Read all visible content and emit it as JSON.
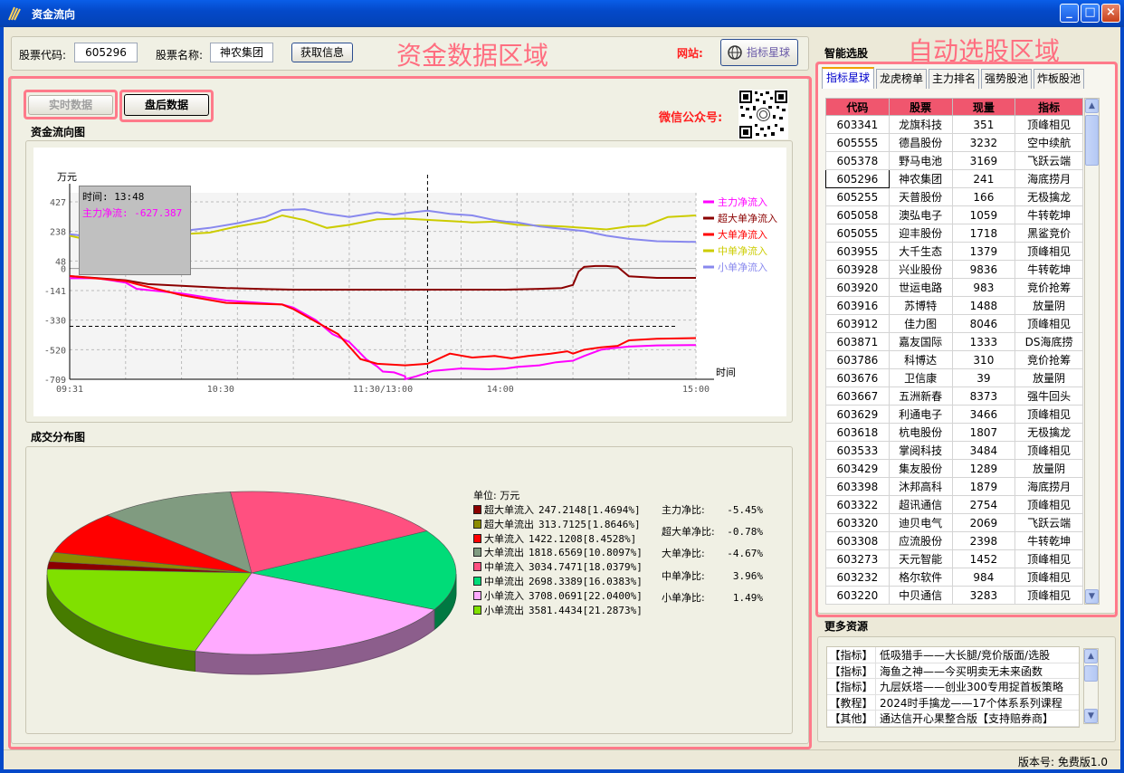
{
  "window": {
    "title": "资金流向"
  },
  "top_bar": {
    "code_label": "股票代码:",
    "code_value": "605296",
    "name_label": "股票名称:",
    "name_value": "神农集团",
    "fetch_button": "获取信息",
    "overlay_label": "资金数据区域",
    "website_label": "网站:",
    "website_button": "指标星球"
  },
  "data_section": {
    "realtime_button": "实时数据",
    "afterhours_button": "盘后数据",
    "wechat_label": "微信公众号:",
    "flow_chart_title": "资金流向图",
    "distribution_title": "成交分布图"
  },
  "tooltip": {
    "time": "时间: 13:48",
    "value": "主力净流: -627.387"
  },
  "chart_data": [
    {
      "type": "line",
      "title": "",
      "ylabel": "万元",
      "xlabel": "时间",
      "y_ticks": [
        "427",
        "238",
        "48",
        "0",
        "-141",
        "-330",
        "-520",
        "-709"
      ],
      "x_ticks": [
        "09:31",
        "10:30",
        "11:30/13:00",
        "14:00",
        "15:00"
      ],
      "ylim": [
        -709,
        427
      ],
      "grid": true,
      "legend": "top-right",
      "crosshair": {
        "x": "13:48",
        "y": -370
      },
      "series": [
        {
          "name": "主力净流入",
          "color": "#ff00ff",
          "values": [
            [
              0,
              -62
            ],
            [
              0.05,
              -62
            ],
            [
              0.1,
              -90
            ],
            [
              0.12,
              -130
            ],
            [
              0.2,
              -160
            ],
            [
              0.28,
              -205
            ],
            [
              0.38,
              -230
            ],
            [
              0.4,
              -250
            ],
            [
              0.44,
              -330
            ],
            [
              0.47,
              -420
            ],
            [
              0.5,
              -470
            ],
            [
              0.53,
              -580
            ],
            [
              0.55,
              -627
            ],
            [
              0.56,
              -660
            ],
            [
              0.58,
              -665
            ],
            [
              0.6,
              -690
            ],
            [
              0.6,
              -709
            ],
            [
              0.62,
              -690
            ],
            [
              0.65,
              -655
            ],
            [
              0.7,
              -640
            ],
            [
              0.75,
              -645
            ],
            [
              0.78,
              -640
            ],
            [
              0.8,
              -630
            ],
            [
              0.84,
              -620
            ],
            [
              0.87,
              -600
            ],
            [
              0.9,
              -590
            ],
            [
              0.92,
              -560
            ],
            [
              0.95,
              -520
            ],
            [
              0.97,
              -510
            ],
            [
              1.0,
              -500
            ],
            [
              1.05,
              -492
            ],
            [
              1.12,
              -490
            ]
          ]
        },
        {
          "name": "超大单净流入",
          "color": "#8b0000",
          "values": [
            [
              0,
              -48
            ],
            [
              0.1,
              -75
            ],
            [
              0.14,
              -100
            ],
            [
              0.2,
              -110
            ],
            [
              0.28,
              -125
            ],
            [
              0.35,
              -132
            ],
            [
              0.4,
              -135
            ],
            [
              0.5,
              -135
            ],
            [
              0.6,
              -135
            ],
            [
              0.7,
              -135
            ],
            [
              0.78,
              -135
            ],
            [
              0.84,
              -130
            ],
            [
              0.88,
              -125
            ],
            [
              0.9,
              -105
            ],
            [
              0.91,
              -20
            ],
            [
              0.92,
              10
            ],
            [
              0.94,
              16
            ],
            [
              0.96,
              16
            ],
            [
              0.98,
              10
            ],
            [
              1.0,
              -50
            ],
            [
              1.05,
              -60
            ],
            [
              1.12,
              -60
            ]
          ]
        },
        {
          "name": "大单净流入",
          "color": "#ff0000",
          "values": [
            [
              0,
              -48
            ],
            [
              0.1,
              -80
            ],
            [
              0.12,
              -100
            ],
            [
              0.2,
              -170
            ],
            [
              0.28,
              -220
            ],
            [
              0.38,
              -230
            ],
            [
              0.4,
              -260
            ],
            [
              0.45,
              -360
            ],
            [
              0.48,
              -420
            ],
            [
              0.52,
              -580
            ],
            [
              0.55,
              -610
            ],
            [
              0.6,
              -620
            ],
            [
              0.64,
              -610
            ],
            [
              0.68,
              -545
            ],
            [
              0.72,
              -570
            ],
            [
              0.76,
              -560
            ],
            [
              0.79,
              -575
            ],
            [
              0.82,
              -560
            ],
            [
              0.86,
              -545
            ],
            [
              0.89,
              -530
            ],
            [
              0.9,
              -545
            ],
            [
              0.92,
              -520
            ],
            [
              0.95,
              -505
            ],
            [
              0.98,
              -495
            ],
            [
              1.0,
              -460
            ],
            [
              1.05,
              -450
            ],
            [
              1.12,
              -445
            ]
          ]
        },
        {
          "name": "中单净流入",
          "color": "#cccc00",
          "values": [
            [
              0,
              210
            ],
            [
              0.05,
              170
            ],
            [
              0.1,
              205
            ],
            [
              0.15,
              190
            ],
            [
              0.2,
              220
            ],
            [
              0.25,
              230
            ],
            [
              0.3,
              270
            ],
            [
              0.35,
              300
            ],
            [
              0.38,
              340
            ],
            [
              0.42,
              310
            ],
            [
              0.46,
              260
            ],
            [
              0.5,
              280
            ],
            [
              0.55,
              315
            ],
            [
              0.6,
              320
            ],
            [
              0.65,
              310
            ],
            [
              0.7,
              300
            ],
            [
              0.72,
              295
            ],
            [
              0.76,
              300
            ],
            [
              0.8,
              280
            ],
            [
              0.84,
              275
            ],
            [
              0.88,
              270
            ],
            [
              0.92,
              260
            ],
            [
              0.96,
              250
            ],
            [
              1.0,
              270
            ],
            [
              1.03,
              275
            ],
            [
              1.07,
              330
            ],
            [
              1.12,
              340
            ]
          ]
        },
        {
          "name": "小单净流入",
          "color": "#8888ee",
          "values": [
            [
              0,
              220
            ],
            [
              0.05,
              200
            ],
            [
              0.1,
              210
            ],
            [
              0.15,
              205
            ],
            [
              0.2,
              240
            ],
            [
              0.25,
              260
            ],
            [
              0.3,
              290
            ],
            [
              0.35,
              330
            ],
            [
              0.38,
              375
            ],
            [
              0.42,
              380
            ],
            [
              0.46,
              350
            ],
            [
              0.5,
              330
            ],
            [
              0.55,
              360
            ],
            [
              0.58,
              345
            ],
            [
              0.6,
              355
            ],
            [
              0.64,
              370
            ],
            [
              0.68,
              350
            ],
            [
              0.72,
              340
            ],
            [
              0.76,
              310
            ],
            [
              0.78,
              300
            ],
            [
              0.8,
              295
            ],
            [
              0.84,
              270
            ],
            [
              0.88,
              255
            ],
            [
              0.92,
              240
            ],
            [
              0.96,
              210
            ],
            [
              1.0,
              190
            ],
            [
              1.05,
              175
            ],
            [
              1.12,
              170
            ]
          ]
        }
      ]
    },
    {
      "type": "pie",
      "title": "",
      "unit_label": "单位: 万元",
      "slices": [
        {
          "name": "超大单流入",
          "value": 247.2148,
          "pct": "1.4694%",
          "color": "#8b0000"
        },
        {
          "name": "超大单流出",
          "value": 313.7125,
          "pct": "1.8646%",
          "color": "#8b8b00"
        },
        {
          "name": "大单流入",
          "value": 1422.1208,
          "pct": "8.4528%",
          "color": "#ff0000"
        },
        {
          "name": "大单流出",
          "value": 1818.6569,
          "pct": "10.8097%",
          "color": "#809b80"
        },
        {
          "name": "中单流入",
          "value": 3034.7471,
          "pct": "18.0379%",
          "color": "#ff5080"
        },
        {
          "name": "中单流出",
          "value": 2698.3389,
          "pct": "16.0383%",
          "color": "#00dc78"
        },
        {
          "name": "小单流入",
          "value": 3708.0691,
          "pct": "22.0400%",
          "color": "#ffaaff"
        },
        {
          "name": "小单流出",
          "value": 3581.4434,
          "pct": "21.2873%",
          "color": "#80e000"
        }
      ]
    }
  ],
  "legend_rows": [
    {
      "name": "超大单流入",
      "text": "247.2148[1.4694%]",
      "color": "#8b0000"
    },
    {
      "name": "超大单流出",
      "text": "313.7125[1.8646%]",
      "color": "#8b8b00"
    },
    {
      "name": "大单流入",
      "text": "1422.1208[8.4528%]",
      "color": "#ff0000"
    },
    {
      "name": "大单流出",
      "text": "1818.6569[10.8097%]",
      "color": "#809b80"
    },
    {
      "name": "中单流入",
      "text": "3034.7471[18.0379%]",
      "color": "#ff5080"
    },
    {
      "name": "中单流出",
      "text": "2698.3389[16.0383%]",
      "color": "#00dc78"
    },
    {
      "name": "小单流入",
      "text": "3708.0691[22.0400%]",
      "color": "#ffaaff"
    },
    {
      "name": "小单流出",
      "text": "3581.4434[21.2873%]",
      "color": "#80e000"
    }
  ],
  "ratios": [
    {
      "label": "主力净比:",
      "value": "-5.45%"
    },
    {
      "label": "超大单净比:",
      "value": "-0.78%"
    },
    {
      "label": "大单净比:",
      "value": "-4.67%"
    },
    {
      "label": "中单净比:",
      "value": "3.96%"
    },
    {
      "label": "小单净比:",
      "value": "1.49%"
    }
  ],
  "right_panel": {
    "section_title": "智能选股",
    "overlay_label": "自动选股区域",
    "tabs": [
      "指标星球",
      "龙虎榜单",
      "主力排名",
      "强势股池",
      "炸板股池"
    ],
    "columns": [
      "代码",
      "股票",
      "现量",
      "指标"
    ],
    "rows": [
      [
        "603341",
        "龙旗科技",
        "351",
        "顶峰相见"
      ],
      [
        "605555",
        "德昌股份",
        "3232",
        "空中续航"
      ],
      [
        "605378",
        "野马电池",
        "3169",
        "飞跃云端"
      ],
      [
        "605296",
        "神农集团",
        "241",
        "海底捞月"
      ],
      [
        "605255",
        "天普股份",
        "166",
        "无极擒龙"
      ],
      [
        "605058",
        "澳弘电子",
        "1059",
        "牛转乾坤"
      ],
      [
        "605055",
        "迎丰股份",
        "1718",
        "黑鲨竞价"
      ],
      [
        "603955",
        "大千生态",
        "1379",
        "顶峰相见"
      ],
      [
        "603928",
        "兴业股份",
        "9836",
        "牛转乾坤"
      ],
      [
        "603920",
        "世运电路",
        "983",
        "竞价抢筹"
      ],
      [
        "603916",
        "苏博特",
        "1488",
        "放量阴"
      ],
      [
        "603912",
        "佳力图",
        "8046",
        "顶峰相见"
      ],
      [
        "603871",
        "嘉友国际",
        "1333",
        "DS海底捞"
      ],
      [
        "603786",
        "科博达",
        "310",
        "竞价抢筹"
      ],
      [
        "603676",
        "卫信康",
        "39",
        "放量阴"
      ],
      [
        "603667",
        "五洲新春",
        "8373",
        "强牛回头"
      ],
      [
        "603629",
        "利通电子",
        "3466",
        "顶峰相见"
      ],
      [
        "603618",
        "杭电股份",
        "1807",
        "无极擒龙"
      ],
      [
        "603533",
        "掌阅科技",
        "3484",
        "顶峰相见"
      ],
      [
        "603429",
        "集友股份",
        "1289",
        "放量阴"
      ],
      [
        "603398",
        "沐邦高科",
        "1879",
        "海底捞月"
      ],
      [
        "603322",
        "超讯通信",
        "2754",
        "顶峰相见"
      ],
      [
        "603320",
        "迪贝电气",
        "2069",
        "飞跃云端"
      ],
      [
        "603308",
        "应流股份",
        "2398",
        "牛转乾坤"
      ],
      [
        "603273",
        "天元智能",
        "1452",
        "顶峰相见"
      ],
      [
        "603232",
        "格尔软件",
        "984",
        "顶峰相见"
      ],
      [
        "603220",
        "中贝通信",
        "3283",
        "顶峰相见"
      ]
    ],
    "selected_row": 3,
    "more_title": "更多资源",
    "resources": [
      {
        "tag": "【指标】",
        "name": "低吸猎手——大长腿/竞价版面/选股"
      },
      {
        "tag": "【指标】",
        "name": "海鱼之神——今买明卖无未来函数"
      },
      {
        "tag": "【指标】",
        "name": "九层妖塔——创业300专用捉首板策略"
      },
      {
        "tag": "【教程】",
        "name": "2024时手擒龙——17个体系系列课程"
      },
      {
        "tag": "【其他】",
        "name": "通达信开心果整合版【支持赔券商】"
      }
    ]
  },
  "status": {
    "version": "版本号: 免费版1.0"
  }
}
